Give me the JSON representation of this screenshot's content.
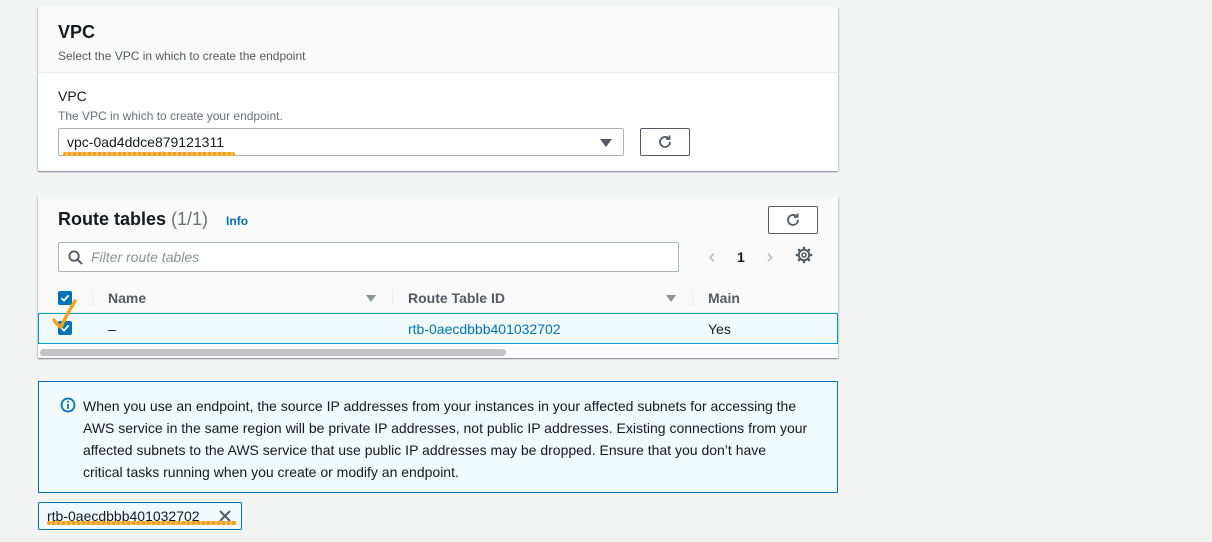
{
  "vpc_section": {
    "title": "VPC",
    "description": "Select the VPC in which to create the endpoint",
    "field_label": "VPC",
    "field_description": "The VPC in which to create your endpoint.",
    "selected_vpc": "vpc-0ad4ddce879121311"
  },
  "route_tables": {
    "title": "Route tables",
    "count": "(1/1)",
    "info_label": "Info",
    "filter_placeholder": "Filter route tables",
    "page_number": "1",
    "columns": [
      "Name",
      "Route Table ID",
      "Main"
    ],
    "rows": [
      {
        "name": "–",
        "route_table_id": "rtb-0aecdbbb401032702",
        "main": "Yes",
        "selected": true
      }
    ]
  },
  "alert": {
    "lines": [
      "When you use an endpoint, the source IP addresses from your instances in your affected subnets for accessing the",
      "AWS service in the same region will be private IP addresses, not public IP addresses. Existing connections from your",
      "affected subnets to the AWS service that use public IP addresses may be dropped. Ensure that you don’t have",
      "critical tasks running when you create or modify an endpoint."
    ]
  },
  "selected_token": {
    "label": "rtb-0aecdbbb401032702"
  },
  "colors": {
    "accent": "#0073bb",
    "selection_border": "#00a1c9",
    "annotation": "#f7a11a"
  }
}
